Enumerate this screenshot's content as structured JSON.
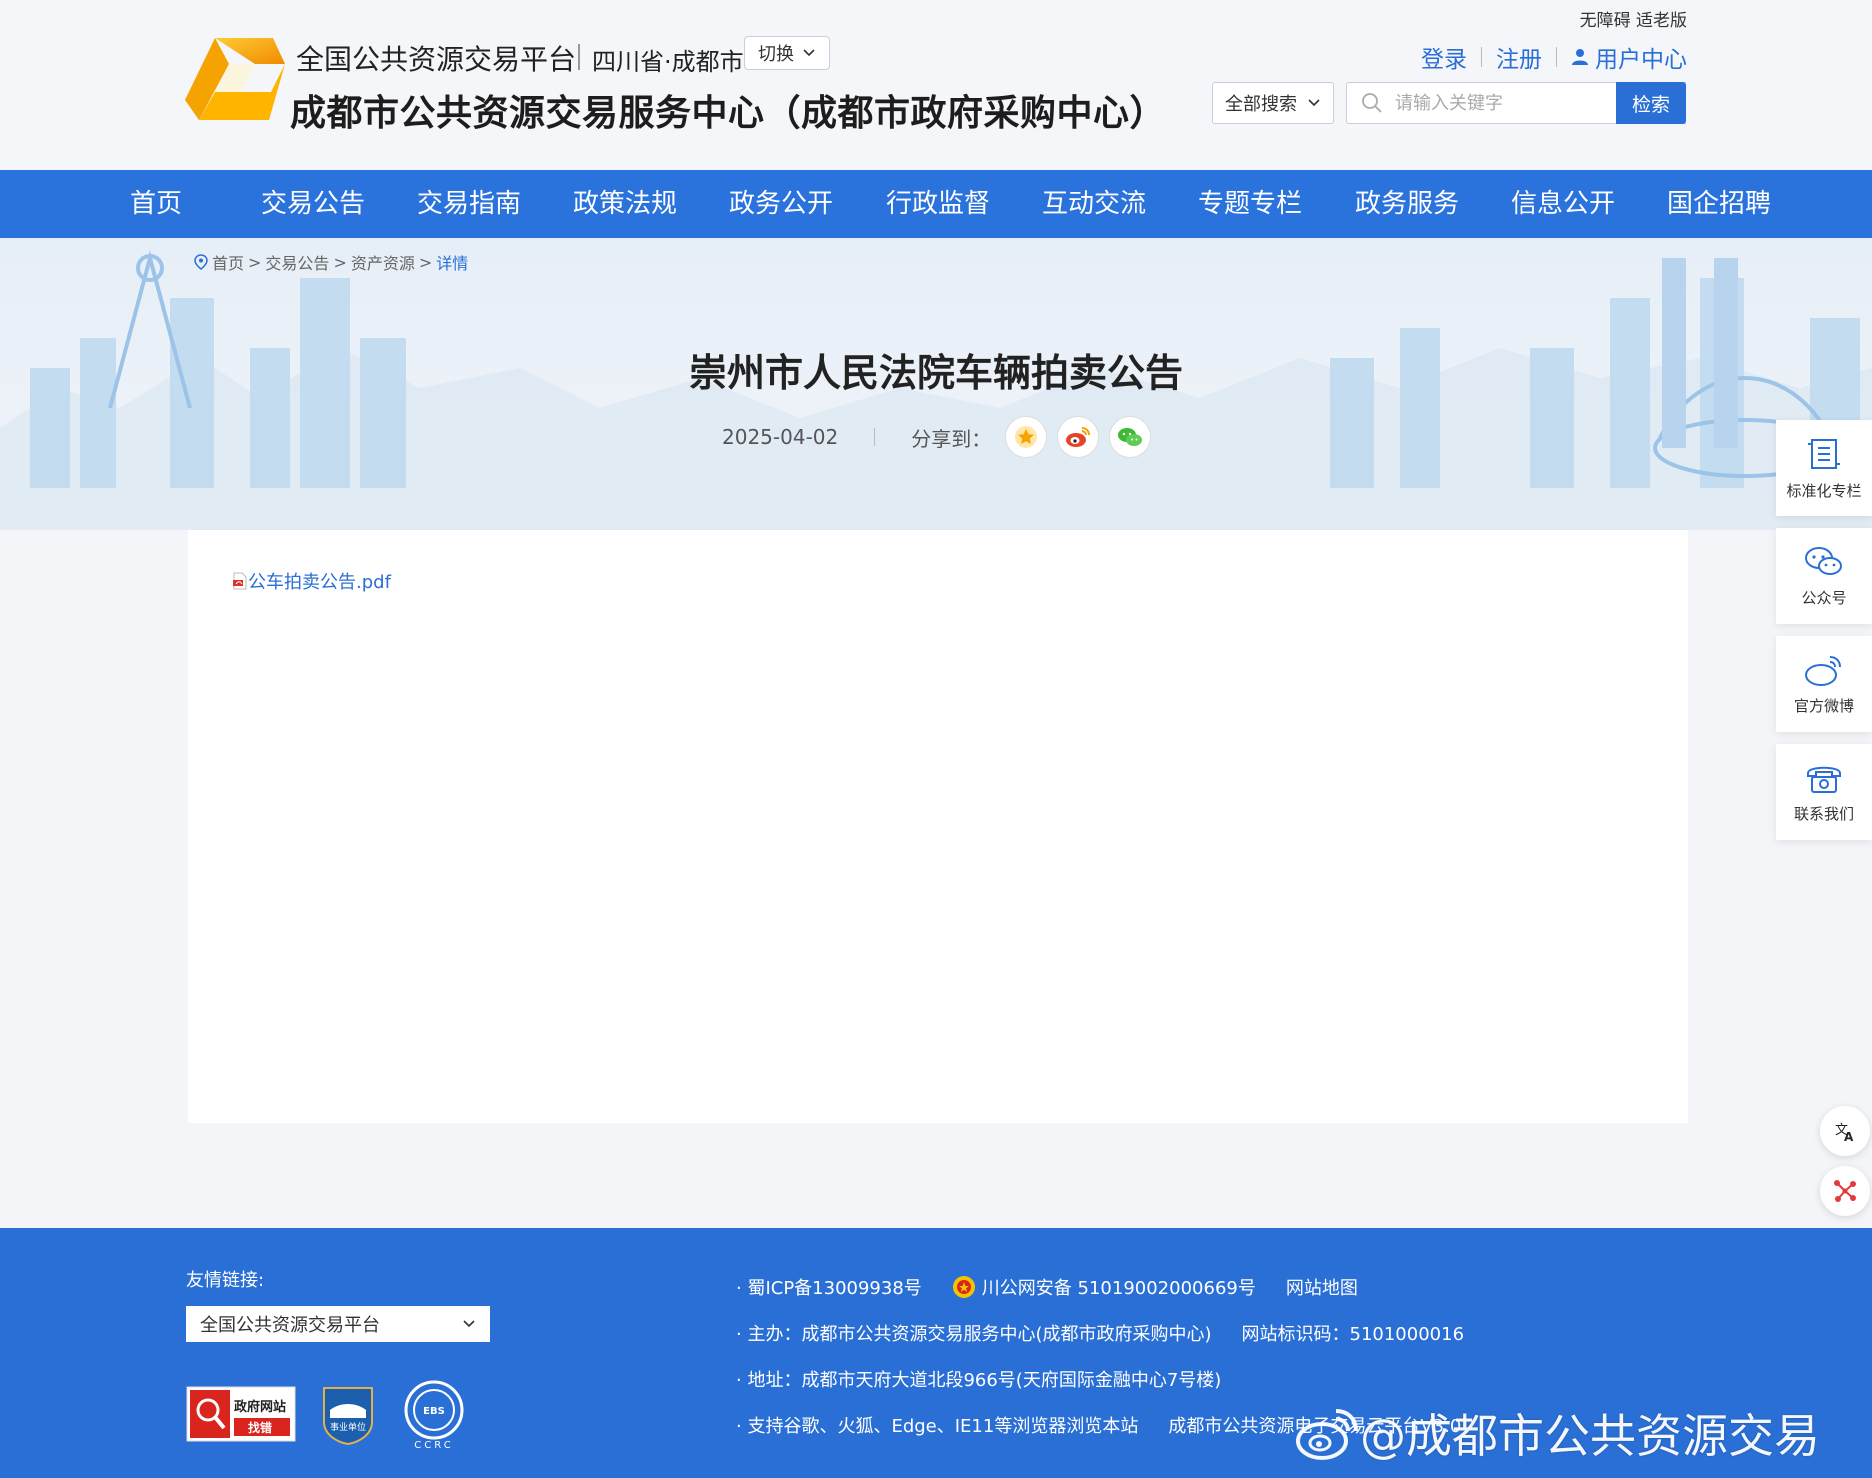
{
  "header": {
    "platform_title": "全国公共资源交易平台",
    "region": "四川省·成都市",
    "switch_label": "切换",
    "center_title": "成都市公共资源交易服务中心（成都市政府采购中心）",
    "accessibility": "无障碍 适老版",
    "login": "登录",
    "register": "注册",
    "user_center": "用户中心",
    "search_type": "全部搜索",
    "search_placeholder": "请输入关键字",
    "search_button": "检索"
  },
  "nav": {
    "items": [
      "首页",
      "交易公告",
      "交易指南",
      "政策法规",
      "政务公开",
      "行政监督",
      "互动交流",
      "专题专栏",
      "政务服务",
      "信息公开",
      "国企招聘"
    ]
  },
  "breadcrumb": {
    "items": [
      "首页",
      "交易公告",
      "资产资源"
    ],
    "separator": ">",
    "current": "详情"
  },
  "article": {
    "title": "崇州市人民法院车辆拍卖公告",
    "date": "2025-04-02",
    "share_label": "分享到：",
    "attachment": "公车拍卖公告.pdf"
  },
  "side": {
    "items": [
      "标准化专栏",
      "公众号",
      "官方微博",
      "联系我们"
    ]
  },
  "footer": {
    "friend_label": "友情链接:",
    "friend_select": "全国公共资源交易平台",
    "icp": "· 蜀ICP备13009938号",
    "police": "川公网安备 51019002000669号",
    "sitemap": "网站地图",
    "sponsor": "· 主办：成都市公共资源交易服务中心(成都市政府采购中心)",
    "site_code": "网站标识码：5101000016",
    "address": "· 地址：成都市天府大道北段966号(天府国际金融中心7号楼)",
    "browser": "· 支持谷歌、火狐、Edge、IE11等浏览器浏览本站",
    "platform_partial": "成都市公共资源电子交易云平台V3.0",
    "badge_1_line1": "政府网站",
    "badge_1_line2": "找错",
    "badge_2": "事业单位",
    "badge_3_top": "EBS",
    "badge_3_bottom": "CCRC",
    "watermark": "@成都市公共资源交易"
  },
  "colors": {
    "primary": "#2a72dc",
    "link": "#2a6fd6",
    "background": "#f3f5f8"
  }
}
